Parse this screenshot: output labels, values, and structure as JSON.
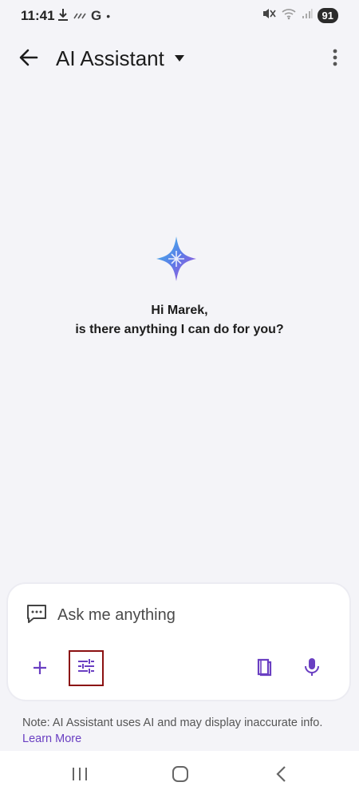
{
  "status_bar": {
    "time": "11:41",
    "left_icons": [
      "download-icon",
      "signal-wave-icon",
      "google-icon",
      "dot-icon"
    ],
    "google_letter": "G",
    "dot": "•",
    "right_icons": [
      "mute-icon",
      "wifi-icon",
      "cell-signal-icon"
    ],
    "battery": "91"
  },
  "app_bar": {
    "title": "AI Assistant",
    "back_icon": "arrow-left-icon",
    "dropdown_icon": "caret-down-icon",
    "more_icon": "more-vert-icon"
  },
  "greeting": {
    "line1": "Hi Marek,",
    "line2": "is there anything I can do for you?",
    "icon": "sparkle-icon"
  },
  "input": {
    "placeholder": "Ask me anything",
    "value": "",
    "icon": "chat-bubble-icon",
    "add_icon": "plus-icon",
    "settings_icon": "tune-icon",
    "book_icon": "book-icon",
    "mic_icon": "mic-icon"
  },
  "disclaimer": {
    "text": "Note: AI Assistant uses AI and may display inaccurate info.",
    "link": "Learn More"
  },
  "nav": {
    "recents_icon": "recents-icon",
    "home_icon": "home-icon",
    "back_icon": "back-chevron-icon"
  },
  "colors": {
    "accent": "#6a3fc2",
    "background": "#f4f4f8",
    "highlight_border": "#8b1111"
  }
}
